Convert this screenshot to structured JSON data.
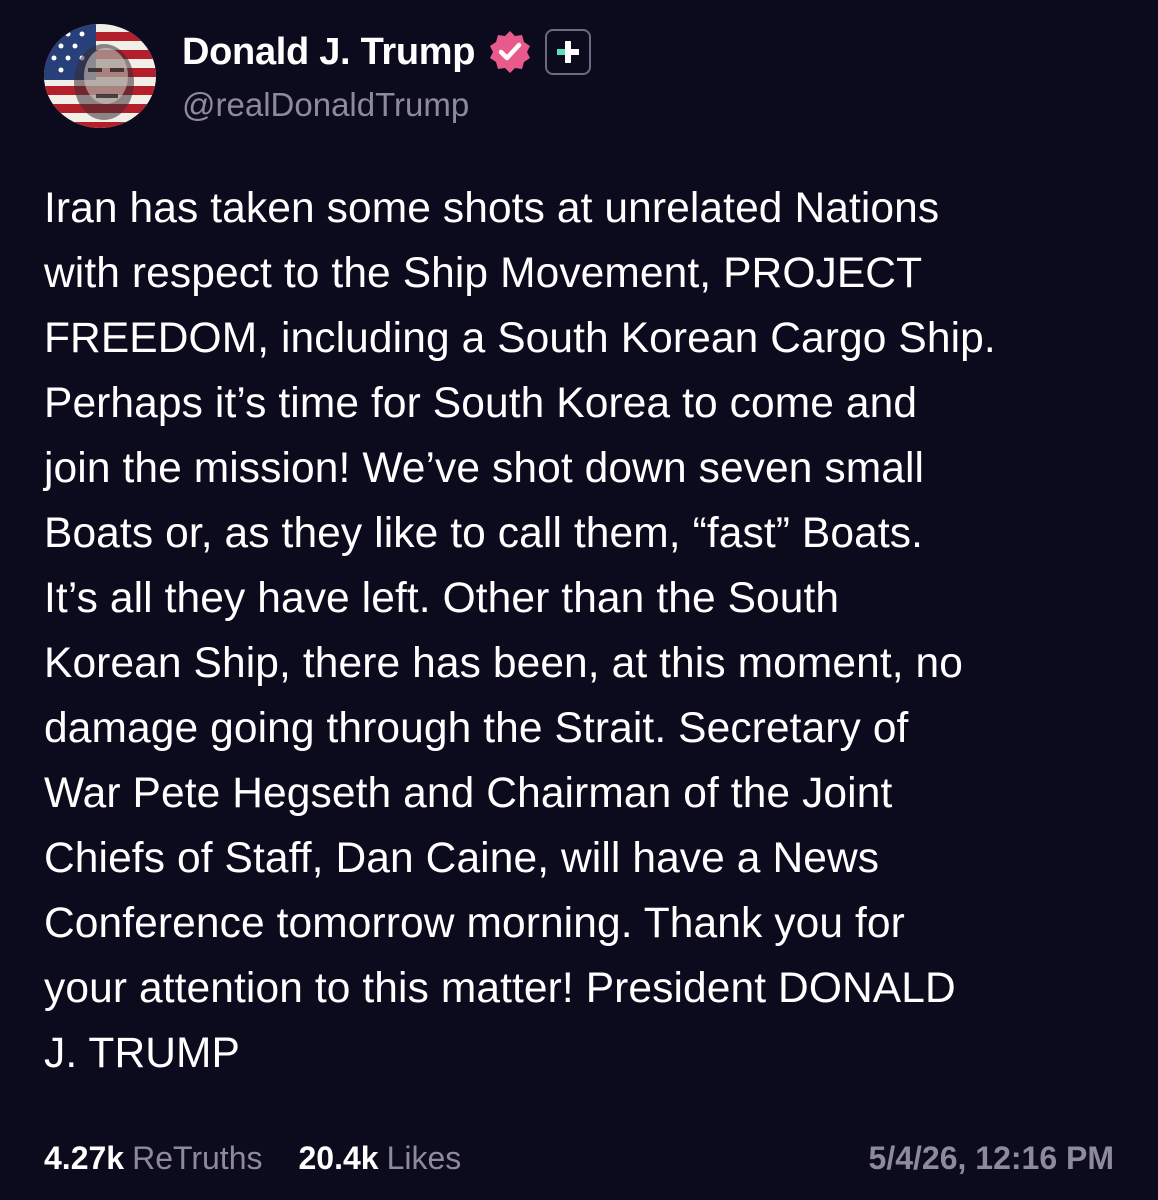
{
  "author": {
    "display_name": "Donald J. Trump",
    "handle": "@realDonaldTrump",
    "avatar_icon": "flag-portrait-avatar",
    "verified_icon": "verified-badge-icon",
    "plus_icon": "plus-badge-icon",
    "verified_color": "#e85a8b"
  },
  "post": {
    "text": "Iran has taken some shots at unrelated Nations\nwith respect to the Ship Movement, PROJECT\nFREEDOM, including a South Korean Cargo Ship.\nPerhaps it’s time for South Korea to come and\njoin the mission! We’ve shot down seven small\nBoats or, as they like to call them, “fast” Boats.\nIt’s all they have left. Other than the South\nKorean Ship, there has been, at this moment, no\ndamage going through the Strait. Secretary of\nWar Pete Hegseth and Chairman of the Joint\nChiefs of Staff, Dan Caine, will have a News\nConference tomorrow morning. Thank you for\nyour attention to this matter! President DONALD\nJ. TRUMP"
  },
  "stats": {
    "retruths_count": "4.27k",
    "retruths_label": "ReTruths",
    "likes_count": "20.4k",
    "likes_label": "Likes",
    "timestamp": "5/4/26, 12:16 PM"
  },
  "colors": {
    "background": "#0c0a1d",
    "text_primary": "#ffffff",
    "text_secondary": "#8d8a9c",
    "plus_accent": "#5ce0b8"
  }
}
